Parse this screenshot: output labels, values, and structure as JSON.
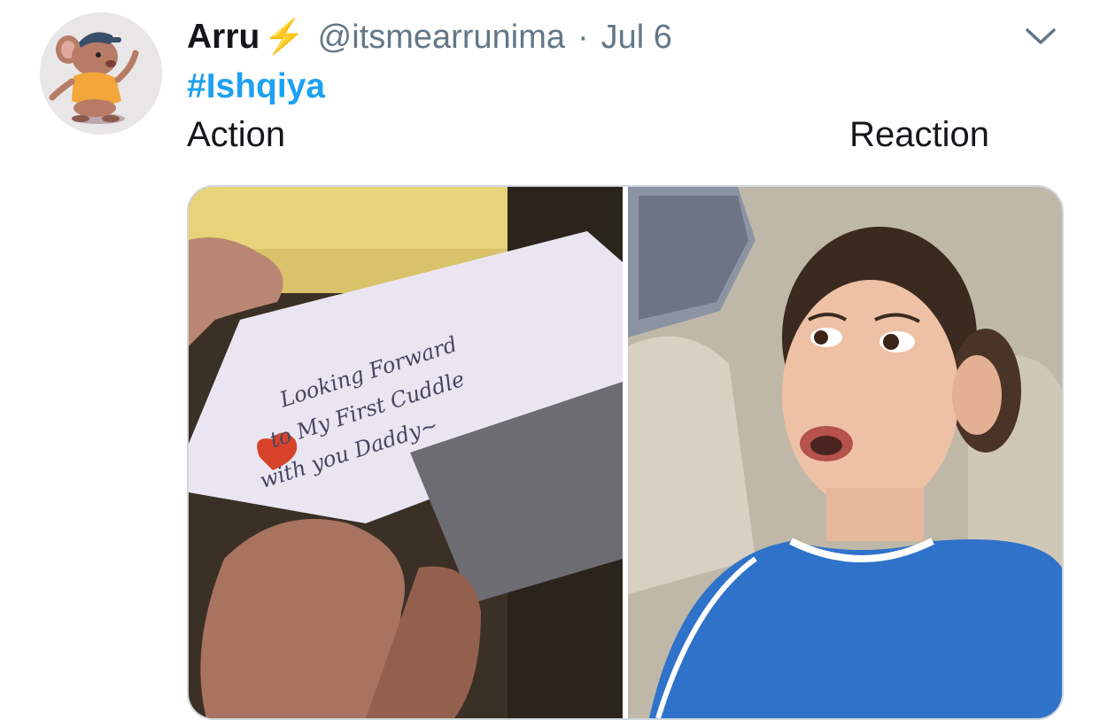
{
  "tweet": {
    "display_name": "Arru",
    "name_emoji": "⚡",
    "handle": "@itsmearrunima",
    "separator": "·",
    "date": "Jul 6",
    "hashtag": "#Ishqiya",
    "text_left": "Action",
    "text_right": "Reaction"
  },
  "media": {
    "left_card_text": [
      "Looking Forward",
      "to My First Cuddle",
      "with you Daddy~"
    ]
  },
  "colors": {
    "hashtag": "#1da1f2",
    "meta": "#657786",
    "text": "#14171a",
    "bolt": "#f5a623"
  },
  "icons": {
    "caret": "chevron-down-icon",
    "bolt": "lightning-emoji"
  }
}
